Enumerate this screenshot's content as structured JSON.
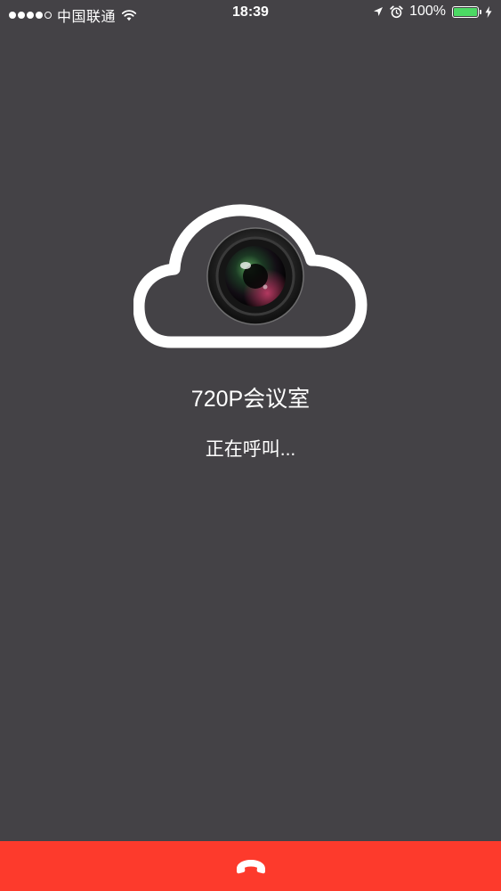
{
  "status_bar": {
    "carrier": "中国联通",
    "time": "18:39",
    "battery_percent": "100%",
    "signal_bars_filled": 4,
    "signal_bars_total": 5,
    "battery_level": 1.0,
    "battery_color": "#4cd964",
    "icons": [
      "signal-dots",
      "wifi-icon",
      "location-arrow-icon",
      "alarm-icon",
      "battery-icon",
      "charging-bolt-icon"
    ]
  },
  "call": {
    "room_name": "720P会议室",
    "status_text": "正在呼叫...",
    "logo_icon": "cloud-camera-icon"
  },
  "hangup": {
    "icon": "phone-hangup-icon",
    "bar_color": "#fd3a2c"
  },
  "colors": {
    "background": "#444246",
    "text": "#ffffff"
  }
}
